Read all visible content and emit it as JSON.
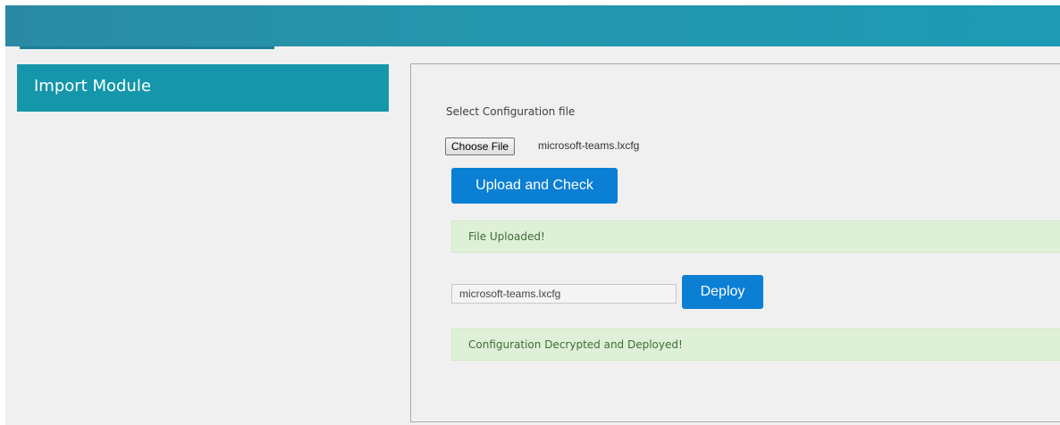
{
  "sidebar": {
    "title": "Import Module"
  },
  "main": {
    "select_label": "Select Configuration file",
    "choose_file_label": "Choose File",
    "selected_file": "microsoft-teams.lxcfg",
    "upload_button": "Upload and Check",
    "upload_alert": "File Uploaded!",
    "deploy_input_value": "microsoft-teams.lxcfg",
    "deploy_button": "Deploy",
    "deploy_alert": "Configuration Decrypted and Deployed!"
  },
  "colors": {
    "header": "#2496ad",
    "sidebar_header": "#1596ab",
    "primary_button": "#0a7fd4",
    "success_alert_bg": "#dff0d8",
    "success_alert_text": "#3c6e35"
  }
}
